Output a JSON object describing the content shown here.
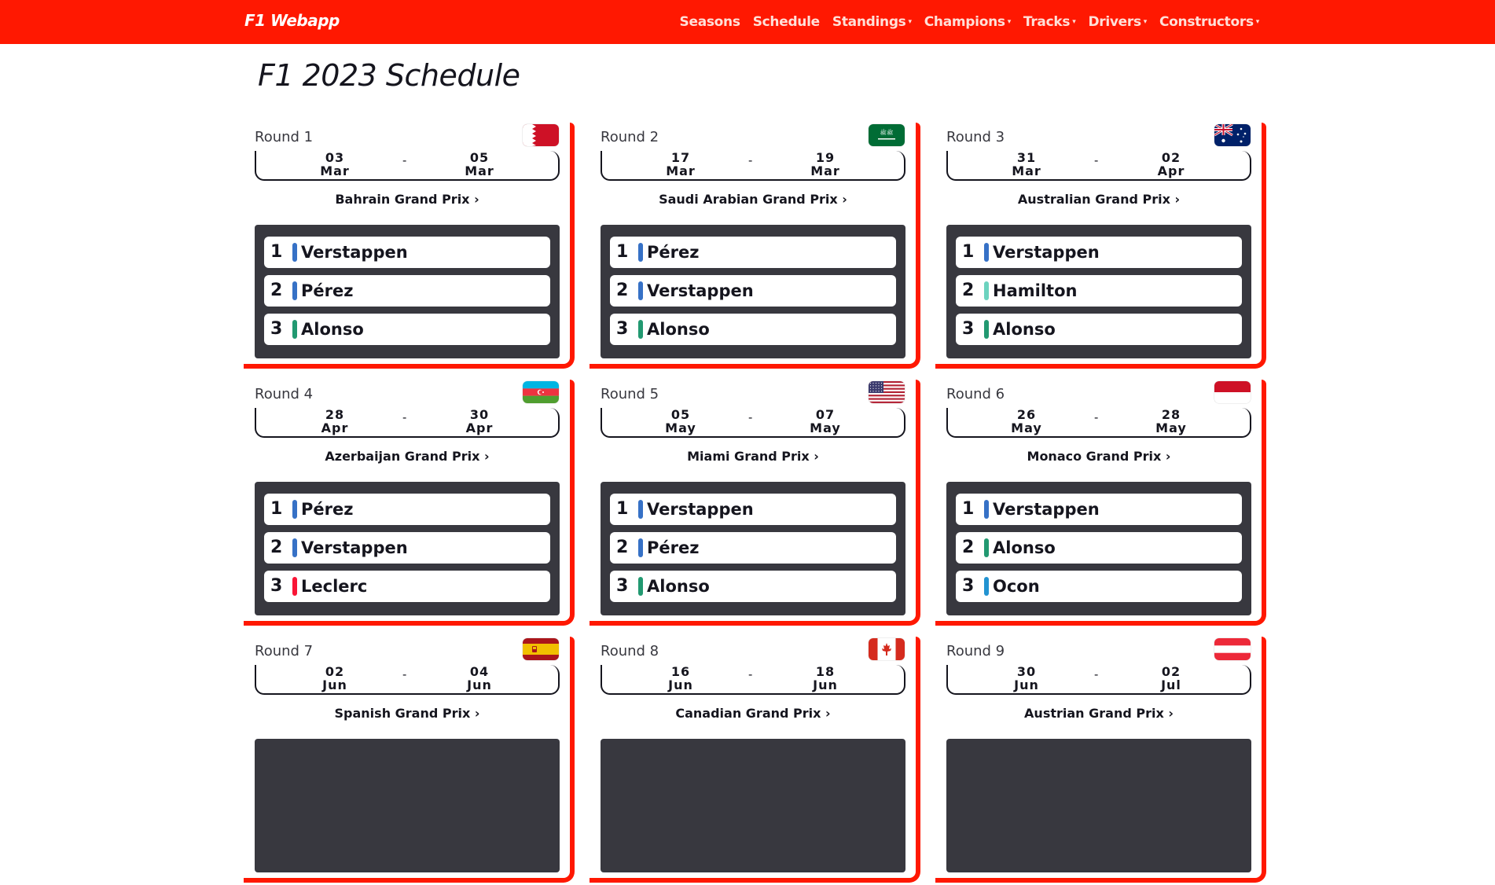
{
  "brand": "F1 Webapp",
  "nav": [
    {
      "label": "Seasons",
      "dropdown": false
    },
    {
      "label": "Schedule",
      "dropdown": false
    },
    {
      "label": "Standings",
      "dropdown": true
    },
    {
      "label": "Champions",
      "dropdown": true
    },
    {
      "label": "Tracks",
      "dropdown": true
    },
    {
      "label": "Drivers",
      "dropdown": true
    },
    {
      "label": "Constructors",
      "dropdown": true
    }
  ],
  "title": "F1 2023 Schedule",
  "colors": {
    "brand_red": "#ff1801",
    "dark": "#38383f",
    "redbull": "#3671c6",
    "aston": "#229971",
    "mercedes": "#6cd3bf",
    "ferrari": "#f91536",
    "alpine": "#2293d1"
  },
  "rounds": [
    {
      "round": "Round 1",
      "flag": "bahrain-flag",
      "start_day": "03",
      "start_month": "Mar",
      "end_day": "05",
      "end_month": "Mar",
      "race": "Bahrain Grand Prix ›",
      "podium": [
        {
          "pos": "1",
          "driver": "Verstappen",
          "color": "#3671c6"
        },
        {
          "pos": "2",
          "driver": "Pérez",
          "color": "#3671c6"
        },
        {
          "pos": "3",
          "driver": "Alonso",
          "color": "#229971"
        }
      ]
    },
    {
      "round": "Round 2",
      "flag": "saudi-arabia-flag",
      "start_day": "17",
      "start_month": "Mar",
      "end_day": "19",
      "end_month": "Mar",
      "race": "Saudi Arabian Grand Prix ›",
      "podium": [
        {
          "pos": "1",
          "driver": "Pérez",
          "color": "#3671c6"
        },
        {
          "pos": "2",
          "driver": "Verstappen",
          "color": "#3671c6"
        },
        {
          "pos": "3",
          "driver": "Alonso",
          "color": "#229971"
        }
      ]
    },
    {
      "round": "Round 3",
      "flag": "australia-flag",
      "start_day": "31",
      "start_month": "Mar",
      "end_day": "02",
      "end_month": "Apr",
      "race": "Australian Grand Prix ›",
      "podium": [
        {
          "pos": "1",
          "driver": "Verstappen",
          "color": "#3671c6"
        },
        {
          "pos": "2",
          "driver": "Hamilton",
          "color": "#6cd3bf"
        },
        {
          "pos": "3",
          "driver": "Alonso",
          "color": "#229971"
        }
      ]
    },
    {
      "round": "Round 4",
      "flag": "azerbaijan-flag",
      "start_day": "28",
      "start_month": "Apr",
      "end_day": "30",
      "end_month": "Apr",
      "race": "Azerbaijan Grand Prix ›",
      "podium": [
        {
          "pos": "1",
          "driver": "Pérez",
          "color": "#3671c6"
        },
        {
          "pos": "2",
          "driver": "Verstappen",
          "color": "#3671c6"
        },
        {
          "pos": "3",
          "driver": "Leclerc",
          "color": "#f91536"
        }
      ]
    },
    {
      "round": "Round 5",
      "flag": "usa-flag",
      "start_day": "05",
      "start_month": "May",
      "end_day": "07",
      "end_month": "May",
      "race": "Miami Grand Prix ›",
      "podium": [
        {
          "pos": "1",
          "driver": "Verstappen",
          "color": "#3671c6"
        },
        {
          "pos": "2",
          "driver": "Pérez",
          "color": "#3671c6"
        },
        {
          "pos": "3",
          "driver": "Alonso",
          "color": "#229971"
        }
      ]
    },
    {
      "round": "Round 6",
      "flag": "monaco-flag",
      "start_day": "26",
      "start_month": "May",
      "end_day": "28",
      "end_month": "May",
      "race": "Monaco Grand Prix ›",
      "podium": [
        {
          "pos": "1",
          "driver": "Verstappen",
          "color": "#3671c6"
        },
        {
          "pos": "2",
          "driver": "Alonso",
          "color": "#229971"
        },
        {
          "pos": "3",
          "driver": "Ocon",
          "color": "#2293d1"
        }
      ]
    },
    {
      "round": "Round 7",
      "flag": "spain-flag",
      "start_day": "02",
      "start_month": "Jun",
      "end_day": "04",
      "end_month": "Jun",
      "race": "Spanish Grand Prix ›",
      "podium": []
    },
    {
      "round": "Round 8",
      "flag": "canada-flag",
      "start_day": "16",
      "start_month": "Jun",
      "end_day": "18",
      "end_month": "Jun",
      "race": "Canadian Grand Prix ›",
      "podium": []
    },
    {
      "round": "Round 9",
      "flag": "austria-flag",
      "start_day": "30",
      "start_month": "Jun",
      "end_day": "02",
      "end_month": "Jul",
      "race": "Austrian Grand Prix ›",
      "podium": []
    }
  ]
}
